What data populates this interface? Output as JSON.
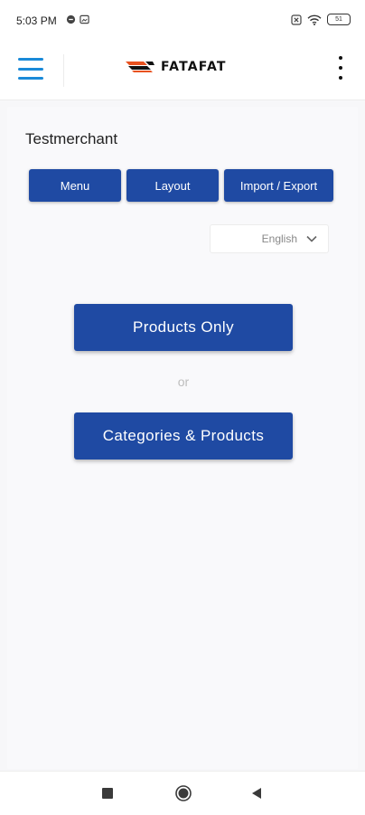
{
  "status_bar": {
    "time": "5:03 PM",
    "battery": "51"
  },
  "header": {
    "brand_name": "FATAFAT",
    "colors": {
      "menu_icon": "#1a8ad8",
      "logo_orange": "#e8511f",
      "logo_dark": "#111111"
    }
  },
  "main": {
    "merchant_name": "Testmerchant",
    "tabs": [
      {
        "label": "Menu"
      },
      {
        "label": "Layout"
      },
      {
        "label": "Import / Export"
      }
    ],
    "language": {
      "selected": "English"
    },
    "options": {
      "products_only_label": "Products Only",
      "or_label": "or",
      "categories_products_label": "Categories & Products"
    },
    "colors": {
      "primary_button": "#1f4aa3",
      "background": "#f9f9fb"
    }
  },
  "icons": {
    "menu": "hamburger-icon",
    "more": "more-vertical-icon",
    "language_dropdown": "chevron-down-icon",
    "nav_recents": "square-icon",
    "nav_home": "circle-icon",
    "nav_back": "triangle-back-icon"
  }
}
